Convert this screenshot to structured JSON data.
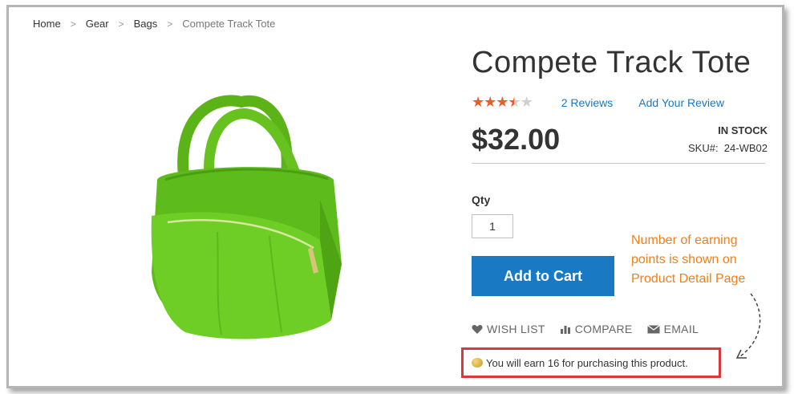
{
  "breadcrumb": {
    "items": [
      "Home",
      "Gear",
      "Bags"
    ],
    "current": "Compete Track Tote",
    "separator": ">"
  },
  "product": {
    "title": "Compete Track Tote",
    "rating_stars": 3.5,
    "rating_max": 5,
    "reviews_link": "2 Reviews",
    "add_review_link": "Add Your Review",
    "price": "$32.00",
    "stock": "IN STOCK",
    "sku_label": "SKU#:",
    "sku_value": "24-WB02",
    "image_icon": "green-tote-bag"
  },
  "form": {
    "qty_label": "Qty",
    "qty_value": "1",
    "add_to_cart_label": "Add to Cart"
  },
  "actions": {
    "wishlist": "WISH LIST",
    "compare": "COMPARE",
    "email": "EMAIL"
  },
  "points": {
    "message": "You will earn 16 for purchasing this product.",
    "icon": "coin-icon"
  },
  "callout": {
    "lines": [
      "Number of earning",
      "points is shown on",
      "Product Detail Page"
    ]
  },
  "colors": {
    "accent": "#1979c3",
    "star": "#f15a22",
    "callout": "#f07f17",
    "highlight_border": "#d9383f",
    "bag_green": "#6cc422"
  }
}
